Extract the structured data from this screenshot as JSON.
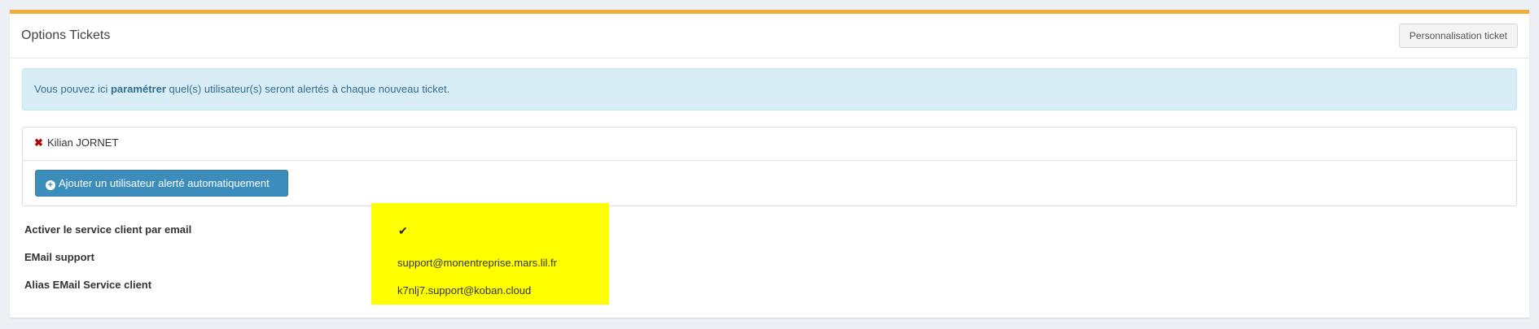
{
  "header": {
    "title": "Options Tickets",
    "customize_button": "Personnalisation ticket"
  },
  "callout": {
    "text_before": "Vous pouvez ici ",
    "text_bold": "paramétrer",
    "text_after": " quel(s) utilisateur(s) seront alertés à chaque nouveau ticket."
  },
  "alerted_users": [
    {
      "name": "Kilian JORNET",
      "icon": "remove-icon"
    }
  ],
  "add_user_button": {
    "label": "Ajouter un utilisateur alerté automatiquement",
    "icon": "plus-circle-icon"
  },
  "settings": [
    {
      "label": "Activer le service client par email",
      "value": "✔",
      "icon": "check-icon"
    },
    {
      "label": "EMail support",
      "value": "support@monentreprise.mars.lil.fr"
    },
    {
      "label": "Alias EMail Service client",
      "value": "k7nlj7.support@koban.cloud"
    }
  ],
  "colors": {
    "accent": "#f0ad3e",
    "primary": "#3c8dbc",
    "highlight": "#ffff00",
    "info_bg": "#d9edf7",
    "danger": "#b30000"
  }
}
